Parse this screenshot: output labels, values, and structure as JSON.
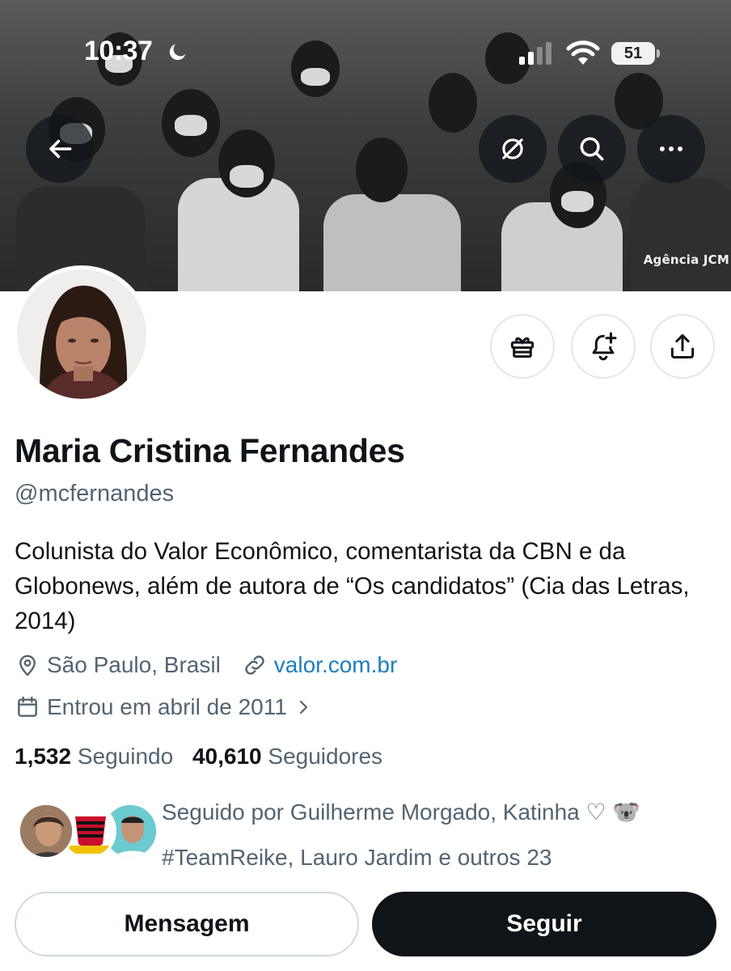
{
  "status_bar": {
    "time": "10:37",
    "battery": "51"
  },
  "banner": {
    "credit": "Agência JCM"
  },
  "profile": {
    "name": "Maria Cristina Fernandes",
    "handle": "@mcfernandes",
    "bio": "Colunista do Valor Econômico, comentarista da CBN e da Globonews, além de autora de “Os candidatos” (Cia das Letras, 2014)",
    "location": "São Paulo, Brasil",
    "website": "valor.com.br",
    "joined": "Entrou em abril de 2011"
  },
  "stats": {
    "following_count": "1,532",
    "following_label": "Seguindo",
    "followers_count": "40,610",
    "followers_label": "Seguidores"
  },
  "followed_by": {
    "line1": "Seguido por Guilherme Morgado, Katinha ♡ 🐨",
    "line2": "#TeamReike, Lauro Jardim e outros 23"
  },
  "buttons": {
    "message": "Mensagem",
    "follow": "Seguir"
  },
  "icons": {
    "back": "back-arrow-icon",
    "translate_off": "eye-slash-icon",
    "search": "search-icon",
    "more": "more-icon",
    "gift": "gift-icon",
    "notify": "bell-plus-icon",
    "share": "share-icon",
    "location": "location-pin-icon",
    "link": "link-icon",
    "calendar": "calendar-icon"
  },
  "colors": {
    "link": "#1d7dc2",
    "primary_text": "#0f1419",
    "secondary_text": "#536471"
  }
}
